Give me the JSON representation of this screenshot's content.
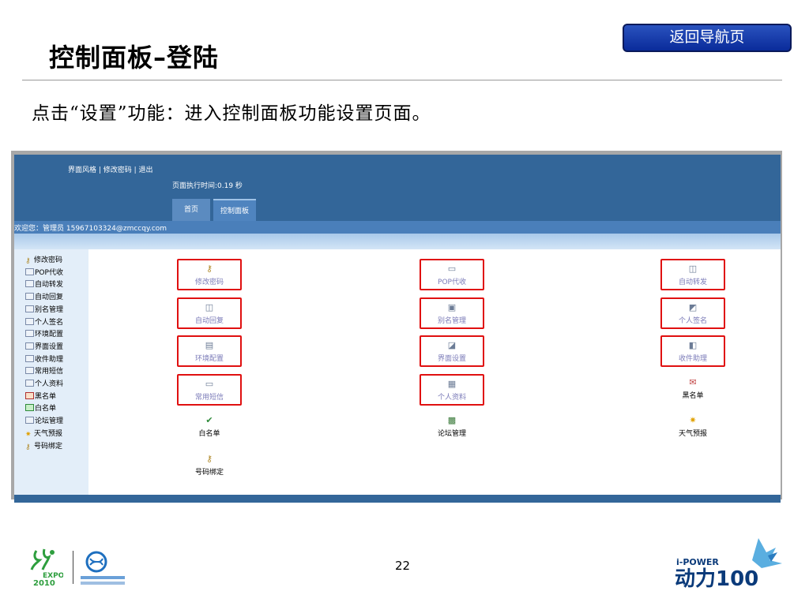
{
  "slide": {
    "title": "控制面板–登陆",
    "nav_button": "返回导航页",
    "instruction": "点击“设置”功能：进入控制面板功能设置页面。",
    "page_number": "22"
  },
  "screenshot": {
    "top_links": "界面风格 | 修改密码 | 退出",
    "exec_time": "页面执行时间:0.19 秒",
    "tabs": [
      {
        "label": "首页",
        "active": false
      },
      {
        "label": "控制面板",
        "active": true
      }
    ],
    "welcome": "欢迎您：管理员  15967103324@zmccqy.com",
    "sidebar": [
      {
        "label": "修改密码",
        "icon": "key-icon"
      },
      {
        "label": "POP代收",
        "icon": "pop-icon"
      },
      {
        "label": "自动转发",
        "icon": "forward-icon"
      },
      {
        "label": "自动回复",
        "icon": "reply-icon"
      },
      {
        "label": "别名管理",
        "icon": "alias-icon"
      },
      {
        "label": "个人签名",
        "icon": "signature-icon"
      },
      {
        "label": "环境配置",
        "icon": "environment-icon"
      },
      {
        "label": "界面设置",
        "icon": "interface-icon"
      },
      {
        "label": "收件助理",
        "icon": "inbox-assistant-icon"
      },
      {
        "label": "常用短信",
        "icon": "sms-icon"
      },
      {
        "label": "个人资料",
        "icon": "profile-icon"
      },
      {
        "label": "黑名单",
        "icon": "blacklist-icon"
      },
      {
        "label": "白名单",
        "icon": "whitelist-icon"
      },
      {
        "label": "论坛管理",
        "icon": "forum-icon"
      },
      {
        "label": "天气预报",
        "icon": "weather-icon"
      },
      {
        "label": "号码绑定",
        "icon": "number-binding-icon"
      }
    ],
    "grid": [
      {
        "label": "修改密码",
        "icon": "key-icon",
        "highlighted": true
      },
      {
        "label": "POP代收",
        "icon": "pop-icon",
        "highlighted": true
      },
      {
        "label": "自动转发",
        "icon": "forward-icon",
        "highlighted": true
      },
      {
        "label": "自动回复",
        "icon": "reply-icon",
        "highlighted": true
      },
      {
        "label": "别名管理",
        "icon": "alias-icon",
        "highlighted": true
      },
      {
        "label": "个人签名",
        "icon": "signature-icon",
        "highlighted": true
      },
      {
        "label": "环境配置",
        "icon": "environment-icon",
        "highlighted": true
      },
      {
        "label": "界面设置",
        "icon": "interface-icon",
        "highlighted": true
      },
      {
        "label": "收件助理",
        "icon": "inbox-assistant-icon",
        "highlighted": true
      },
      {
        "label": "常用短信",
        "icon": "sms-icon",
        "highlighted": true
      },
      {
        "label": "个人资料",
        "icon": "profile-icon",
        "highlighted": true
      },
      {
        "label": "黑名单",
        "icon": "blacklist-icon",
        "highlighted": false
      },
      {
        "label": "白名单",
        "icon": "whitelist-icon",
        "highlighted": false
      },
      {
        "label": "论坛管理",
        "icon": "forum-icon",
        "highlighted": false
      },
      {
        "label": "天气预报",
        "icon": "weather-icon",
        "highlighted": false
      },
      {
        "label": "号码绑定",
        "icon": "number-binding-icon",
        "highlighted": false
      }
    ]
  },
  "logos": {
    "expo_text": "EXPO 2010",
    "ipower_text": "i-POWER",
    "ipower_brand": "动力100"
  },
  "colors": {
    "header_blue": "#336699",
    "highlight_red": "#e01010",
    "nav_button_blue": "#1a40b0"
  }
}
